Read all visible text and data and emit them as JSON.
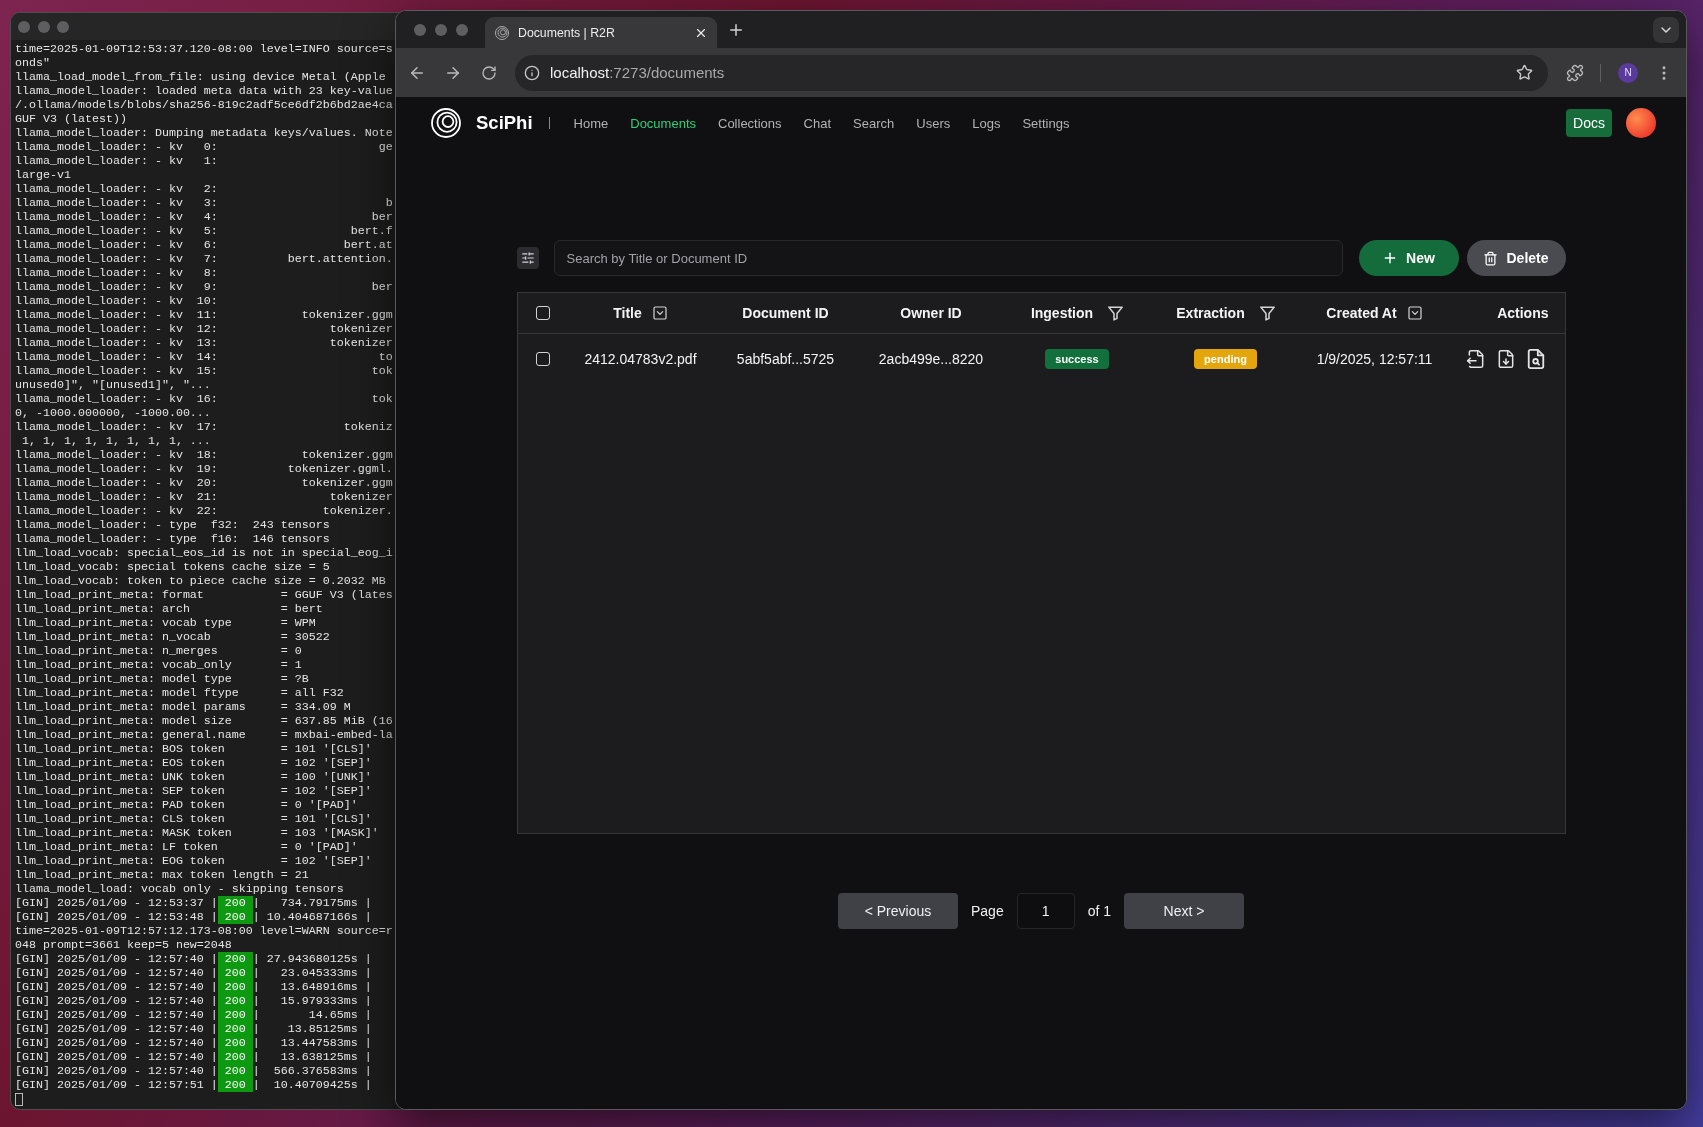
{
  "terminal": {
    "lines": [
      {
        "kind": "text",
        "text": "time=2025-01-09T12:53:37.120-08:00 level=INFO source=s"
      },
      {
        "kind": "text",
        "text": "onds\""
      },
      {
        "kind": "text",
        "text": "llama_load_model_from_file: using device Metal (Apple"
      },
      {
        "kind": "text",
        "text": "llama_model_loader: loaded meta data with 23 key-value"
      },
      {
        "kind": "text",
        "text": "/.ollama/models/blobs/sha256-819c2adf5ce6df2b6bd2ae4ca"
      },
      {
        "kind": "text",
        "text": "GUF V3 (latest))"
      },
      {
        "kind": "text",
        "text": "llama_model_loader: Dumping metadata keys/values. Note"
      },
      {
        "kind": "pair",
        "text": "llama_model_loader: - kv   0:",
        "value": "ge"
      },
      {
        "kind": "text",
        "text": "llama_model_loader: - kv   1:"
      },
      {
        "kind": "text",
        "text": "large-v1"
      },
      {
        "kind": "text",
        "text": "llama_model_loader: - kv   2:"
      },
      {
        "kind": "pair",
        "text": "llama_model_loader: - kv   3:",
        "value": "b"
      },
      {
        "kind": "pair",
        "text": "llama_model_loader: - kv   4:",
        "value": "ber"
      },
      {
        "kind": "pair",
        "text": "llama_model_loader: - kv   5:",
        "value": "bert.f"
      },
      {
        "kind": "pair",
        "text": "llama_model_loader: - kv   6:",
        "value": "bert.at"
      },
      {
        "kind": "pair",
        "text": "llama_model_loader: - kv   7:",
        "value": "bert.attention."
      },
      {
        "kind": "text",
        "text": "llama_model_loader: - kv   8:"
      },
      {
        "kind": "pair",
        "text": "llama_model_loader: - kv   9:",
        "value": "ber"
      },
      {
        "kind": "text",
        "text": "llama_model_loader: - kv  10:"
      },
      {
        "kind": "pair",
        "text": "llama_model_loader: - kv  11:",
        "value": "tokenizer.ggm"
      },
      {
        "kind": "pair",
        "text": "llama_model_loader: - kv  12:",
        "value": "tokenizer"
      },
      {
        "kind": "pair",
        "text": "llama_model_loader: - kv  13:",
        "value": "tokenizer"
      },
      {
        "kind": "pair",
        "text": "llama_model_loader: - kv  14:",
        "value": "to"
      },
      {
        "kind": "pair",
        "text": "llama_model_loader: - kv  15:",
        "value": "tok"
      },
      {
        "kind": "text",
        "text": "unused0]\", \"[unused1]\", \"..."
      },
      {
        "kind": "pair",
        "text": "llama_model_loader: - kv  16:",
        "value": "tok"
      },
      {
        "kind": "text",
        "text": "0, -1000.000000, -1000.00..."
      },
      {
        "kind": "pair",
        "text": "llama_model_loader: - kv  17:",
        "value": "tokeniz"
      },
      {
        "kind": "text",
        "text": " 1, 1, 1, 1, 1, 1, 1, 1, ..."
      },
      {
        "kind": "pair",
        "text": "llama_model_loader: - kv  18:",
        "value": "tokenizer.ggm"
      },
      {
        "kind": "pair",
        "text": "llama_model_loader: - kv  19:",
        "value": "tokenizer.ggml."
      },
      {
        "kind": "pair",
        "text": "llama_model_loader: - kv  20:",
        "value": "tokenizer.ggm"
      },
      {
        "kind": "pair",
        "text": "llama_model_loader: - kv  21:",
        "value": "tokenizer"
      },
      {
        "kind": "pair",
        "text": "llama_model_loader: - kv  22:",
        "value": "tokenizer."
      },
      {
        "kind": "text",
        "text": "llama_model_loader: - type  f32:  243 tensors"
      },
      {
        "kind": "text",
        "text": "llama_model_loader: - type  f16:  146 tensors"
      },
      {
        "kind": "text",
        "text": "llm_load_vocab: special_eos_id is not in special_eog_i"
      },
      {
        "kind": "text",
        "text": "llm_load_vocab: special tokens cache size = 5"
      },
      {
        "kind": "text",
        "text": "llm_load_vocab: token to piece cache size = 0.2032 MB"
      },
      {
        "kind": "field",
        "text": "llm_load_print_meta: format",
        "value": "= GGUF V3 (lates"
      },
      {
        "kind": "field",
        "text": "llm_load_print_meta: arch",
        "value": "= bert"
      },
      {
        "kind": "field",
        "text": "llm_load_print_meta: vocab type",
        "value": "= WPM"
      },
      {
        "kind": "field",
        "text": "llm_load_print_meta: n_vocab",
        "value": "= 30522"
      },
      {
        "kind": "field",
        "text": "llm_load_print_meta: n_merges",
        "value": "= 0"
      },
      {
        "kind": "field",
        "text": "llm_load_print_meta: vocab_only",
        "value": "= 1"
      },
      {
        "kind": "field",
        "text": "llm_load_print_meta: model type",
        "value": "= ?B"
      },
      {
        "kind": "field",
        "text": "llm_load_print_meta: model ftype",
        "value": "= all F32"
      },
      {
        "kind": "field",
        "text": "llm_load_print_meta: model params",
        "value": "= 334.09 M"
      },
      {
        "kind": "field",
        "text": "llm_load_print_meta: model size",
        "value": "= 637.85 MiB (16"
      },
      {
        "kind": "field",
        "text": "llm_load_print_meta: general.name",
        "value": "= mxbai-embed-la"
      },
      {
        "kind": "field",
        "text": "llm_load_print_meta: BOS token",
        "value": "= 101 '[CLS]'"
      },
      {
        "kind": "field",
        "text": "llm_load_print_meta: EOS token",
        "value": "= 102 '[SEP]'"
      },
      {
        "kind": "field",
        "text": "llm_load_print_meta: UNK token",
        "value": "= 100 '[UNK]'"
      },
      {
        "kind": "field",
        "text": "llm_load_print_meta: SEP token",
        "value": "= 102 '[SEP]'"
      },
      {
        "kind": "field",
        "text": "llm_load_print_meta: PAD token",
        "value": "= 0 '[PAD]'"
      },
      {
        "kind": "field",
        "text": "llm_load_print_meta: CLS token",
        "value": "= 101 '[CLS]'"
      },
      {
        "kind": "field",
        "text": "llm_load_print_meta: MASK token",
        "value": "= 103 '[MASK]'"
      },
      {
        "kind": "field",
        "text": "llm_load_print_meta: LF token",
        "value": "= 0 '[PAD]'"
      },
      {
        "kind": "field",
        "text": "llm_load_print_meta: EOG token",
        "value": "= 102 '[SEP]'"
      },
      {
        "kind": "field",
        "text": "llm_load_print_meta: max token length",
        "value": "= 21"
      },
      {
        "kind": "text",
        "text": "llama_model_load: vocab only - skipping tensors"
      },
      {
        "kind": "status",
        "prefix": "[GIN] 2025/01/09 - 12:53:37 |",
        "code": "200",
        "suffix": "|   734.79175ms |"
      },
      {
        "kind": "status",
        "prefix": "[GIN] 2025/01/09 - 12:53:48 |",
        "code": "200",
        "suffix": "| 10.404687166s |"
      },
      {
        "kind": "text",
        "text": "time=2025-01-09T12:57:12.173-08:00 level=WARN source=r"
      },
      {
        "kind": "text",
        "text": "048 prompt=3661 keep=5 new=2048"
      },
      {
        "kind": "status",
        "prefix": "[GIN] 2025/01/09 - 12:57:40 |",
        "code": "200",
        "suffix": "| 27.943680125s |"
      },
      {
        "kind": "status",
        "prefix": "[GIN] 2025/01/09 - 12:57:40 |",
        "code": "200",
        "suffix": "|   23.045333ms |"
      },
      {
        "kind": "status",
        "prefix": "[GIN] 2025/01/09 - 12:57:40 |",
        "code": "200",
        "suffix": "|   13.648916ms |"
      },
      {
        "kind": "status",
        "prefix": "[GIN] 2025/01/09 - 12:57:40 |",
        "code": "200",
        "suffix": "|   15.979333ms |"
      },
      {
        "kind": "status",
        "prefix": "[GIN] 2025/01/09 - 12:57:40 |",
        "code": "200",
        "suffix": "|       14.65ms |"
      },
      {
        "kind": "status",
        "prefix": "[GIN] 2025/01/09 - 12:57:40 |",
        "code": "200",
        "suffix": "|    13.85125ms |"
      },
      {
        "kind": "status",
        "prefix": "[GIN] 2025/01/09 - 12:57:40 |",
        "code": "200",
        "suffix": "|   13.447583ms |"
      },
      {
        "kind": "status",
        "prefix": "[GIN] 2025/01/09 - 12:57:40 |",
        "code": "200",
        "suffix": "|   13.638125ms |"
      },
      {
        "kind": "status",
        "prefix": "[GIN] 2025/01/09 - 12:57:40 |",
        "code": "200",
        "suffix": "|  566.376583ms |"
      },
      {
        "kind": "status",
        "prefix": "[GIN] 2025/01/09 - 12:57:51 |",
        "code": "200",
        "suffix": "|  10.40709425s |"
      }
    ]
  },
  "browser": {
    "tabs": [
      {
        "title": "Documents | R2R",
        "selected": true
      }
    ],
    "address": {
      "host": "localhost",
      "path": ":7273/documents"
    },
    "profile_initial": "N"
  },
  "app": {
    "brand": "SciPhi",
    "nav": [
      {
        "label": "Home",
        "selected": false
      },
      {
        "label": "Documents",
        "selected": true
      },
      {
        "label": "Collections",
        "selected": false
      },
      {
        "label": "Chat",
        "selected": false
      },
      {
        "label": "Search",
        "selected": false
      },
      {
        "label": "Users",
        "selected": false
      },
      {
        "label": "Logs",
        "selected": false
      },
      {
        "label": "Settings",
        "selected": false
      }
    ],
    "docs_button": "Docs",
    "search": {
      "placeholder": "Search by Title or Document ID"
    },
    "actions": [
      {
        "kind": "new",
        "label": "New"
      },
      {
        "kind": "delete",
        "label": "Delete"
      }
    ],
    "table": {
      "header_checkbox": {
        "checked": false
      },
      "columns": [
        {
          "label": "Title",
          "sortable": true,
          "filterable": false
        },
        {
          "label": "Document ID",
          "sortable": false,
          "filterable": false
        },
        {
          "label": "Owner ID",
          "sortable": false,
          "filterable": false
        },
        {
          "label": "Ingestion",
          "sortable": false,
          "filterable": true
        },
        {
          "label": "Extraction",
          "sortable": false,
          "filterable": true
        },
        {
          "label": "Created At",
          "sortable": true,
          "filterable": false
        },
        {
          "label": "Actions",
          "sortable": false,
          "filterable": false
        }
      ],
      "rows": [
        {
          "selected": false,
          "title": "2412.04783v2.pdf",
          "document_id": "5abf5abf...5725",
          "owner_id": "2acb499e...8220",
          "ingestion": {
            "label": "success",
            "color": "#12703c"
          },
          "extraction": {
            "label": "pending",
            "color": "#e3a60c"
          },
          "created_at": "1/9/2025, 12:57:11"
        }
      ]
    },
    "pagination": {
      "previous": "< Previous",
      "page_label": "Page",
      "page": "1",
      "total": "of 1",
      "next": "Next >"
    }
  }
}
